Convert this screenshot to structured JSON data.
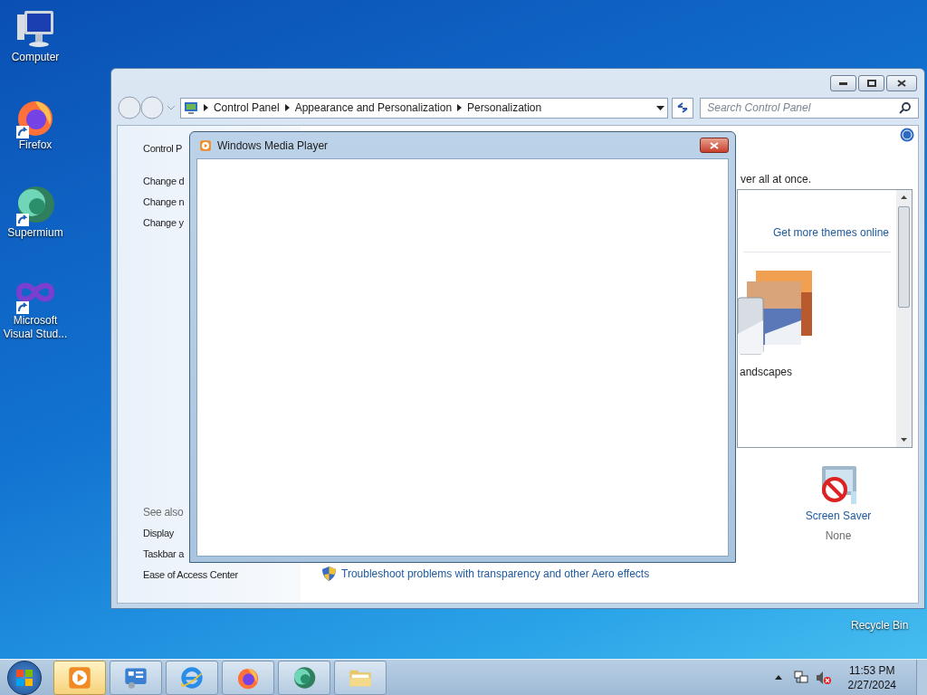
{
  "desktop_icons": [
    {
      "kind": "computer",
      "label": "Computer"
    },
    {
      "kind": "firefox",
      "label": "Firefox"
    },
    {
      "kind": "supermium",
      "label": "Supermium"
    },
    {
      "kind": "visual-studio",
      "label": "Microsoft Visual Stud..."
    }
  ],
  "recycle_bin": {
    "label": "Recycle Bin"
  },
  "control_panel": {
    "breadcrumb": [
      "Control Panel",
      "Appearance and Personalization",
      "Personalization"
    ],
    "search": {
      "placeholder": "Search Control Panel"
    },
    "left_pane": {
      "links": [
        "Control P",
        "Change d",
        "Change n",
        "Change y"
      ],
      "see_also_heading": "See also",
      "see_also": [
        "Display",
        "Taskbar a",
        "Ease of Access Center"
      ]
    },
    "intro_text": "ver all at once.",
    "themes": {
      "link": "Get more themes online",
      "theme_label": "andscapes"
    },
    "screen_saver": {
      "label": "Screen Saver",
      "value": "None"
    },
    "troubleshoot_link": "Troubleshoot problems with transparency and other Aero effects"
  },
  "dialog": {
    "title": "Windows Media Player"
  },
  "taskbar": {
    "buttons": [
      {
        "kind": "media-player",
        "selected": true
      },
      {
        "kind": "control-panel",
        "selected": false
      },
      {
        "kind": "ie",
        "selected": false
      },
      {
        "kind": "firefox",
        "selected": false
      },
      {
        "kind": "supermium",
        "selected": false
      },
      {
        "kind": "explorer",
        "selected": false
      }
    ],
    "time": "11:53 PM",
    "date": "2/27/2024"
  }
}
